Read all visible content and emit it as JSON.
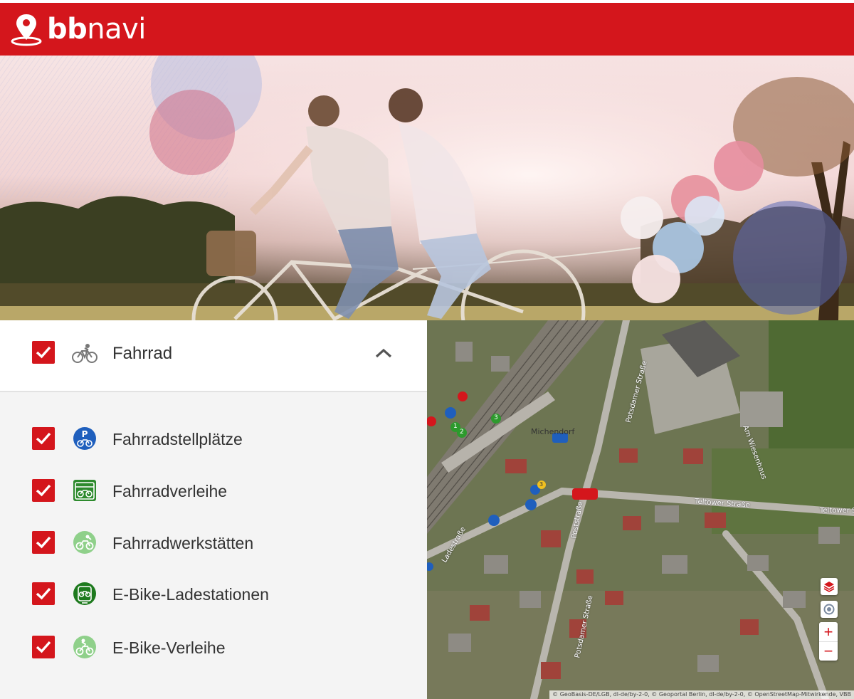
{
  "header": {
    "brand_bold": "bb",
    "brand_regular": "navi"
  },
  "colors": {
    "brand_red": "#d4161c",
    "panel_bg": "#f4f4f4",
    "text": "#333333"
  },
  "category": {
    "label": "Fahrrad",
    "icon": "bicycle-icon",
    "checked": true,
    "expanded": true
  },
  "items": [
    {
      "label": "Fahrradstellplätze",
      "icon": "bike-parking-icon",
      "checked": true
    },
    {
      "label": "Fahrradverleihe",
      "icon": "bike-rental-icon",
      "checked": true
    },
    {
      "label": "Fahrradwerkstätten",
      "icon": "bike-repair-icon",
      "checked": true
    },
    {
      "label": "E-Bike-Ladestationen",
      "icon": "ebike-charging-icon",
      "checked": true
    },
    {
      "label": "E-Bike-Verleihe",
      "icon": "ebike-rental-icon",
      "checked": true
    }
  ],
  "map": {
    "place_label": "Michendorf",
    "streets": {
      "potsdamer_1": "Potsdamer Straße",
      "potsdamer_2": "Potsdamer Straße",
      "teltower_1": "Teltower Straße",
      "teltower_2": "Teltower Straße",
      "poststrasse": "Poststraße",
      "ladestrasse": "Ladestraße",
      "amwerdersee": "Am Wiesenhaus"
    },
    "marker_counts": [
      "1",
      "2",
      "3",
      "3"
    ],
    "zoom_in": "+",
    "zoom_out": "−",
    "attribution": "© GeoBasis-DE/LGB, dl-de/by-2-0, © Geoportal Berlin, dl-de/by-2-0, © OpenStreetMap-Mitwirkende, VBB"
  }
}
